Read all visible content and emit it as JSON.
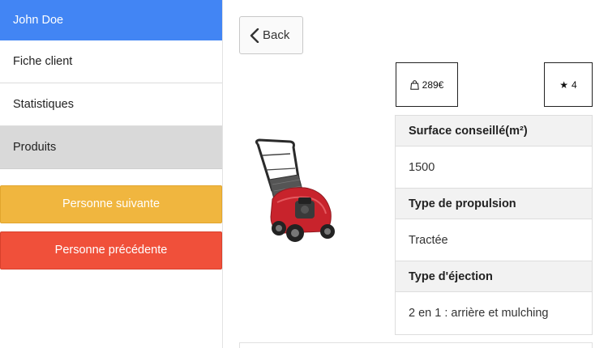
{
  "sidebar": {
    "user_name": "John Doe",
    "items": [
      {
        "label": "Fiche client"
      },
      {
        "label": "Statistiques"
      },
      {
        "label": "Produits"
      }
    ],
    "next_button": "Personne suivante",
    "prev_button": "Personne précédente"
  },
  "main": {
    "back_label": "Back",
    "price": "289€",
    "rating": "4",
    "product_image": "lawn-mower-photo",
    "specs": [
      {
        "label": "Surface conseillé(m²)",
        "value": "1500"
      },
      {
        "label": "Type de propulsion",
        "value": "Tractée"
      },
      {
        "label": "Type d'éjection",
        "value": "2 en 1 : arrière et mulching"
      }
    ]
  },
  "colors": {
    "header_blue": "#4285f4",
    "next_yellow": "#f0b63f",
    "prev_red": "#f0503a",
    "active_gray": "#d9d9d9"
  }
}
